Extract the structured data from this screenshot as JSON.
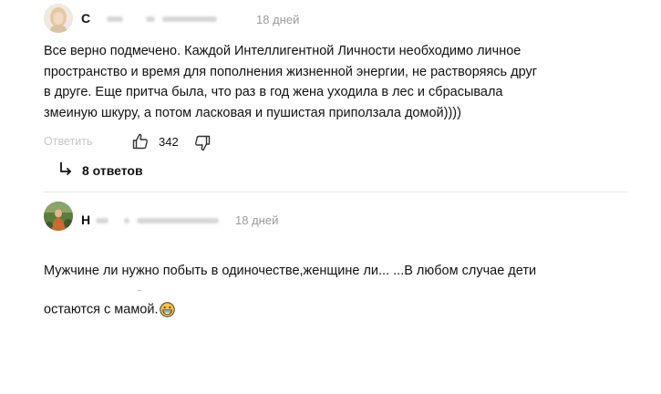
{
  "comments": [
    {
      "author": "С",
      "time": "18 дней",
      "text": "Все верно подмечено. Каждой Интеллигентной Личности необходимо личное\nпространство и время для пополнения жизненной энергии, не растворяясь друг\nв друге. Еще притча была, что раз в год жена уходила в лес и сбрасывала\nзмеиную шкуру, а потом ласковая и пушистая приползала домой))))",
      "reply_label": "Ответить",
      "likes": "342",
      "replies_label": "8 ответов"
    },
    {
      "author": "Н",
      "time": "18 дней",
      "text": "Мужчине ли нужно побыть в одиночестве,женщине ли... ...В любом случае дети\nостаются с мамой.",
      "emoji": "grinning-face-emoji"
    }
  ],
  "icons": {
    "like": "thumbs-up-icon",
    "dislike": "thumbs-down-icon",
    "replies": "reply-arrow-icon"
  },
  "colors": {
    "muted": "#9a9a9a",
    "reply": "#c6c6c6",
    "emoji": "#f5c33b"
  }
}
